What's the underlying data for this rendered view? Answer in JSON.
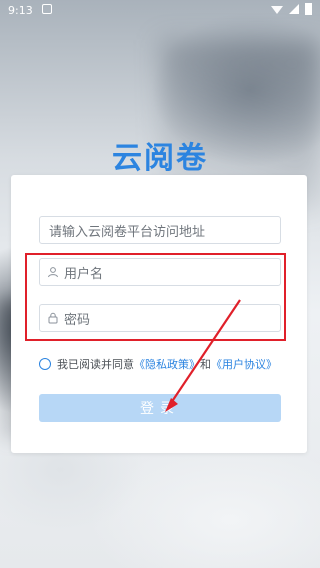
{
  "status_bar": {
    "time": "9:13"
  },
  "app": {
    "title": "云阅卷"
  },
  "form": {
    "url_placeholder": "请输入云阅卷平台访问地址",
    "username_placeholder": "用户名",
    "password_placeholder": "密码"
  },
  "agreement": {
    "prefix": "我已阅读并同意",
    "privacy_link": "《隐私政策》",
    "conjunction": "和",
    "terms_link": "《用户协议》"
  },
  "login_button": {
    "label": "登录"
  },
  "colors": {
    "accent": "#2c84e0",
    "button": "#b7d7f6",
    "highlight": "#e0202a"
  },
  "icons": {
    "user": "user-icon",
    "lock": "lock-icon",
    "wifi": "wifi-icon",
    "signal": "signal-icon",
    "battery": "battery-icon"
  }
}
